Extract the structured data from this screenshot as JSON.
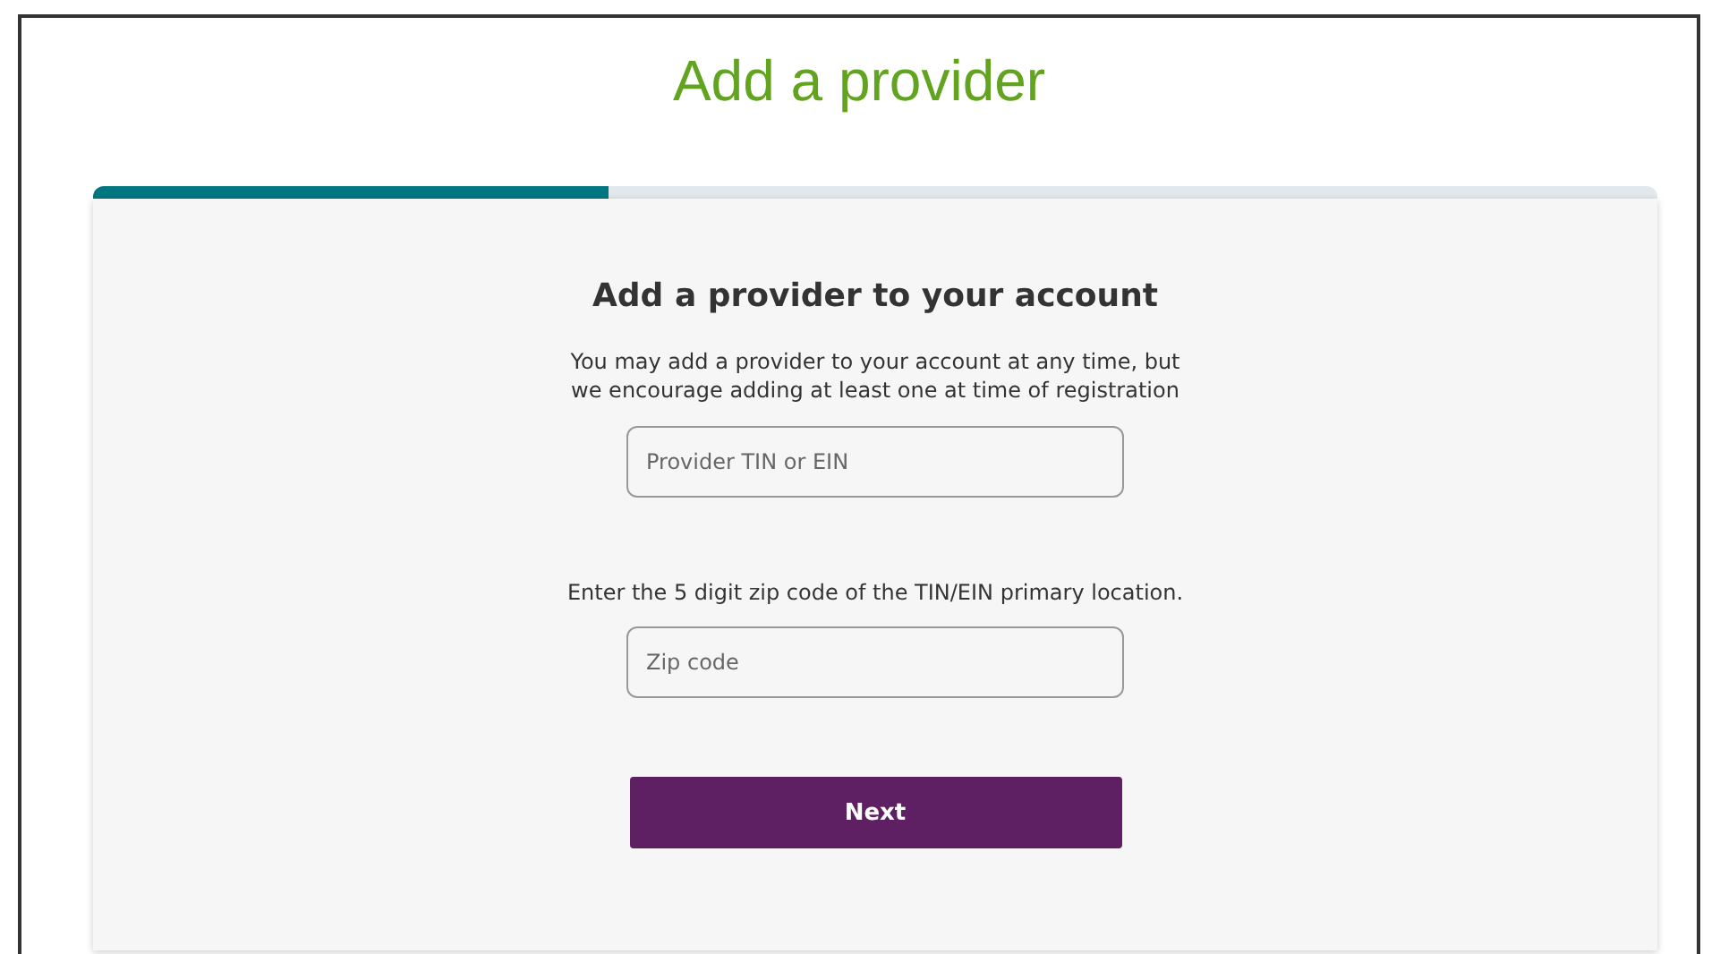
{
  "page_title": "Add a provider",
  "progress": {
    "level": 0.33
  },
  "form": {
    "heading": "Add a provider to your account",
    "intro": "You may add a provider to your account at any time, but we encourage adding at least one at time of registration",
    "fields": [
      {
        "placeholder": "Provider TIN or EIN"
      },
      {
        "label": "Enter the 5 digit zip code of the TIN/EIN primary location.",
        "placeholder": "Zip code"
      }
    ],
    "submit": "Next"
  }
}
